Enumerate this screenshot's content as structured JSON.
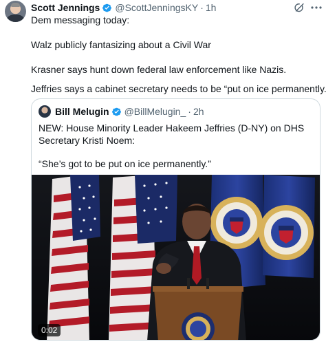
{
  "tweet": {
    "author_name": "Scott Jennings",
    "author_handle": "@ScottJenningsKY",
    "separator": "·",
    "time": "1h",
    "lines": [
      "Dem messaging today:",
      "Walz publicly fantasizing about a Civil War",
      "Krasner says hunt down federal law enforcement like Nazis.",
      "Jeffries says a cabinet secretary needs to be “put on ice permanently.”"
    ]
  },
  "quote": {
    "author_name": "Bill Melugin",
    "author_handle": "@BillMelugin_",
    "separator": "·",
    "time": "2h",
    "text_1": "NEW: House Minority Leader Hakeem Jeffries (D-NY) on DHS Secretary Kristi Noem:",
    "text_2": "“She’s got to be put on ice permanently.”",
    "video_timestamp": "0:02"
  },
  "icons": {
    "verified": "verified-badge-icon",
    "grok": "grok-icon",
    "more": "more-options-icon"
  },
  "colors": {
    "verified_blue": "#1d9bf0",
    "secondary_text": "#536471",
    "border": "#cfd9de"
  }
}
